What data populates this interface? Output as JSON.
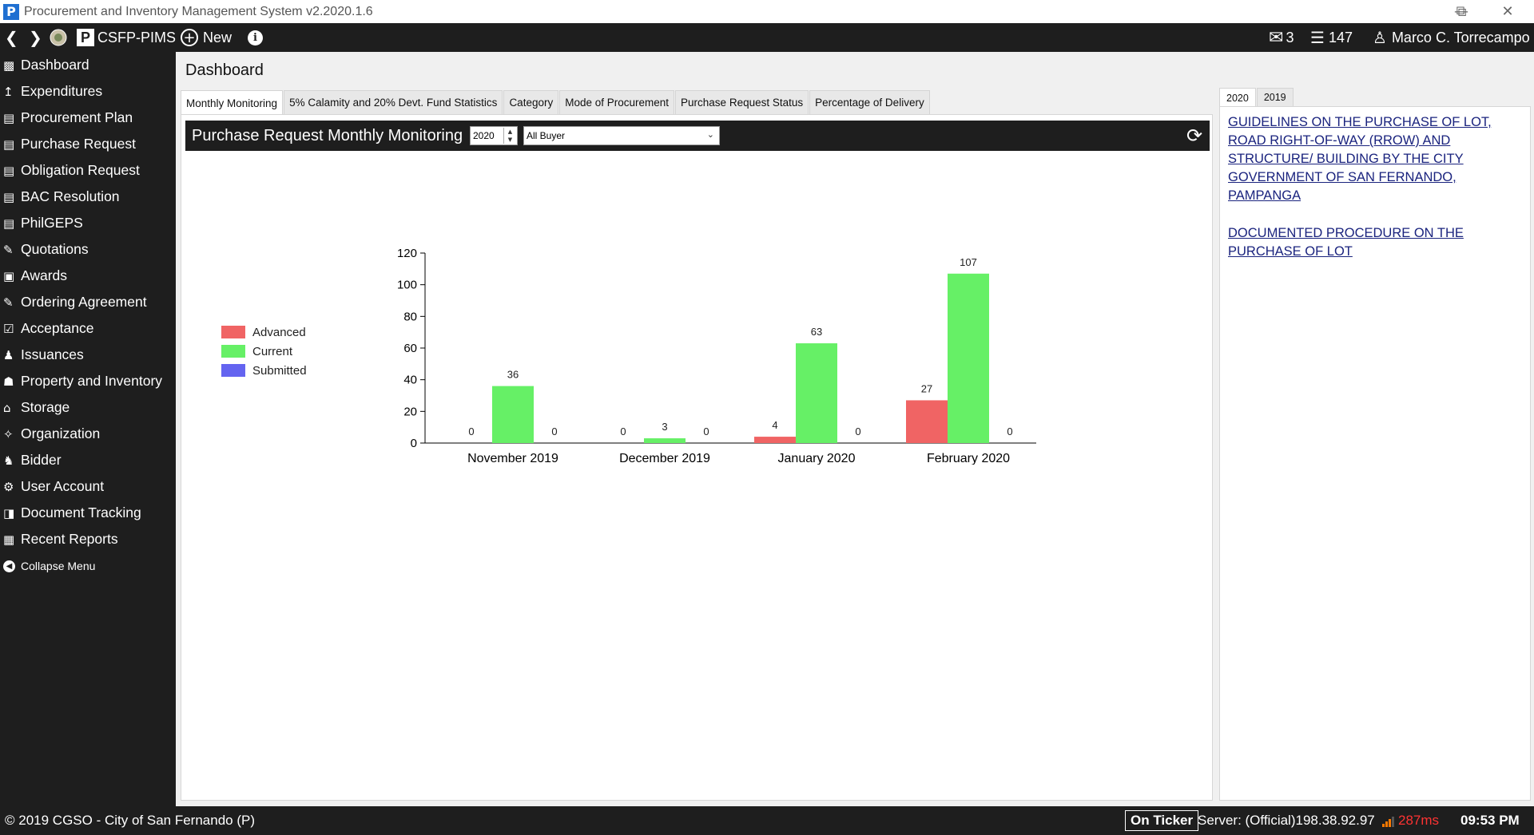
{
  "window": {
    "title": "Procurement and Inventory Management System v2.2020.1.6",
    "app_icon": "P",
    "controls": [
      "minimize-icon",
      "restore-icon",
      "close-icon"
    ]
  },
  "toolbar": {
    "app_name": "CSFP-PIMS",
    "new_label": "New",
    "messages_count": "3",
    "tasks_count": "147",
    "user_name": "Marco C. Torrecampo"
  },
  "sidebar": {
    "items": [
      {
        "label": "Dashboard",
        "icon": "dashboard-icon"
      },
      {
        "label": "Expenditures",
        "icon": "chart-icon"
      },
      {
        "label": "Procurement Plan",
        "icon": "plan-icon"
      },
      {
        "label": "Purchase Request",
        "icon": "document-icon"
      },
      {
        "label": "Obligation Request",
        "icon": "document-icon"
      },
      {
        "label": "BAC Resolution",
        "icon": "document-icon"
      },
      {
        "label": "PhilGEPS",
        "icon": "document-icon"
      },
      {
        "label": "Quotations",
        "icon": "edit-icon"
      },
      {
        "label": "Awards",
        "icon": "award-icon"
      },
      {
        "label": "Ordering Agreement",
        "icon": "edit-icon"
      },
      {
        "label": "Acceptance",
        "icon": "acceptance-icon"
      },
      {
        "label": "Issuances",
        "icon": "issuance-icon"
      },
      {
        "label": "Property and Inventory",
        "icon": "property-icon"
      },
      {
        "label": "Storage",
        "icon": "storage-icon"
      },
      {
        "label": "Organization",
        "icon": "organization-icon"
      },
      {
        "label": "Bidder",
        "icon": "bidder-icon"
      },
      {
        "label": "User Account",
        "icon": "user-account-icon"
      },
      {
        "label": "Document Tracking",
        "icon": "tracking-icon"
      },
      {
        "label": "Recent Reports",
        "icon": "reports-icon"
      }
    ],
    "collapse_label": "Collapse Menu"
  },
  "main": {
    "page_title": "Dashboard",
    "tabs": [
      "Monthly Monitoring",
      "5% Calamity and 20% Devt. Fund Statistics",
      "Category",
      "Mode of Procurement",
      "Purchase Request Status",
      "Percentage of Delivery"
    ],
    "chart_panel": {
      "title": "Purchase Request Monthly Monitoring",
      "year_value": "2020",
      "buyer_value": "All Buyer"
    }
  },
  "chart_data": {
    "type": "bar",
    "categories": [
      "November 2019",
      "December 2019",
      "January 2020",
      "February 2020"
    ],
    "series": [
      {
        "name": "Advanced",
        "color": "#f06464",
        "values": [
          0,
          0,
          4,
          27
        ]
      },
      {
        "name": "Current",
        "color": "#66f066",
        "values": [
          36,
          3,
          63,
          107
        ]
      },
      {
        "name": "Submitted",
        "color": "#6464f0",
        "values": [
          0,
          0,
          0,
          0
        ]
      }
    ],
    "ylim": [
      0,
      120
    ],
    "yticks": [
      0,
      20,
      40,
      60,
      80,
      100,
      120
    ],
    "legend_position": "left",
    "grid": false
  },
  "right_panel": {
    "tabs": [
      "2020",
      "2019"
    ],
    "links": [
      "GUIDELINES ON THE PURCHASE OF LOT, ROAD RIGHT-OF-WAY (RROW) AND STRUCTURE/ BUILDING BY THE CITY GOVERNMENT OF SAN FERNANDO, PAMPANGA",
      "DOCUMENTED PROCEDURE ON THE PURCHASE OF LOT"
    ]
  },
  "statusbar": {
    "copyright": "© 2019 CGSO - City of San Fernando (P)",
    "ticker_label": "On Ticker",
    "server": "Server: (Official)198.38.92.97",
    "latency": "287ms",
    "latency_color": "#ff3333",
    "time": "09:53 PM"
  }
}
